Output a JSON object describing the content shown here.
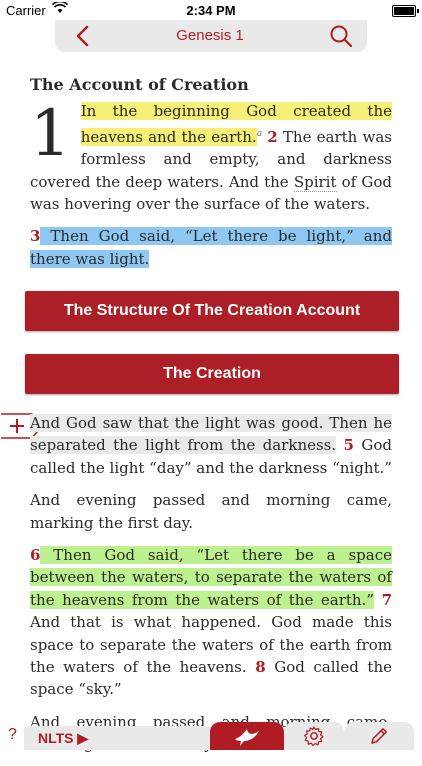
{
  "status_bar": {
    "carrier": "Carrier",
    "time": "2:34 PM"
  },
  "nav": {
    "book_title": "Genesis 1"
  },
  "section_heading": "The Account of Creation",
  "chapter_number": "1",
  "paragraphs": {
    "p1": {
      "v1_text": "In the beginning God created the heavens and the earth.",
      "footnote": "a",
      "v2_num": "2",
      "v2_text_a": " The earth was formless and empty, and darkness covered the deep waters. And the ",
      "v2_spirit": "Spirit",
      "v2_text_b": " of God was hovering over the surface of the waters."
    },
    "p2": {
      "v3_num": "3",
      "v3_text": " Then God said, “Let there be light,” and there was light."
    },
    "p3": {
      "v4_text": "And God saw that the light was good. Then he separated the light from the darkness.",
      "v5_num": "5",
      "v5_text": " God called the light “day” and the darkness “night.”"
    },
    "p4": {
      "text": "And evening passed and morning came, marking the first day."
    },
    "p5": {
      "v6_num": "6",
      "v6_text": " Then God said, “Let there be a space between the waters, to separate the waters of the heavens from the waters of the earth.”",
      "v7_num": "7",
      "v7_text": " And that is what happened. God made this space to separate the waters of the earth from the waters of the heavens.",
      "v8_num": "8",
      "v8_text": " God called the space “sky.”"
    },
    "p6": {
      "text": "And evening passed and morning came, marking the second day."
    }
  },
  "buttons": {
    "structure": "The Structure Of The Creation Account",
    "creation": "The Creation"
  },
  "toolbar": {
    "help": "?",
    "translation": "NLTS ▶"
  },
  "colors": {
    "accent": "#b01c24",
    "highlight_yellow": "#f5ef78",
    "highlight_blue": "#8ec8f2",
    "highlight_green": "#bdf08f"
  },
  "icons": [
    "back-chevron-icon",
    "search-icon",
    "plus-icon",
    "bird-icon",
    "gear-icon",
    "pencil-icon"
  ]
}
